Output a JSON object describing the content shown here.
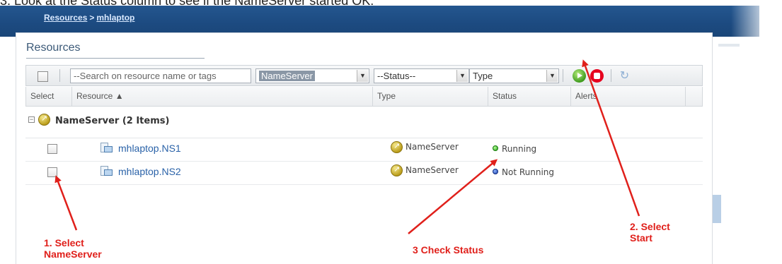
{
  "instruction": "3.    Look at the Status column to see if the NameServer started OK.",
  "breadcrumb": {
    "root": "Resources",
    "separator": ">",
    "current": "mhlaptop"
  },
  "panel": {
    "title": "Resources"
  },
  "toolbar": {
    "search": {
      "placeholder": "--Search on resource name or tags"
    },
    "type_filter": {
      "value": "NameServer"
    },
    "status_filter": {
      "value": "--Status--"
    },
    "type_select": {
      "value": "Type"
    },
    "icons": [
      "play-icon",
      "stop-icon",
      "refresh-icon"
    ]
  },
  "grid": {
    "columns": {
      "select": "Select",
      "resource": "Resource ▲",
      "type": "Type",
      "status": "Status",
      "alerts": "Alerts"
    },
    "group": {
      "label": "NameServer (2 Items)",
      "expander": "−"
    },
    "rows": [
      {
        "name": "mhlaptop.NS1",
        "type": "NameServer",
        "status": "Running",
        "status_color": "#1f9b10"
      },
      {
        "name": "mhlaptop.NS2",
        "type": "NameServer",
        "status": "Not Running",
        "status_color": "#1a3fa8"
      }
    ]
  },
  "annotations": {
    "step1_line1": "1. Select",
    "step1_line2": "NameServer",
    "step2_line1": "2. Select",
    "step2_line2": "Start",
    "step3": "3 Check Status"
  },
  "colors": {
    "header_bar": "#1c4a80",
    "annotation": "#e0201b",
    "link": "#2a62a8"
  }
}
